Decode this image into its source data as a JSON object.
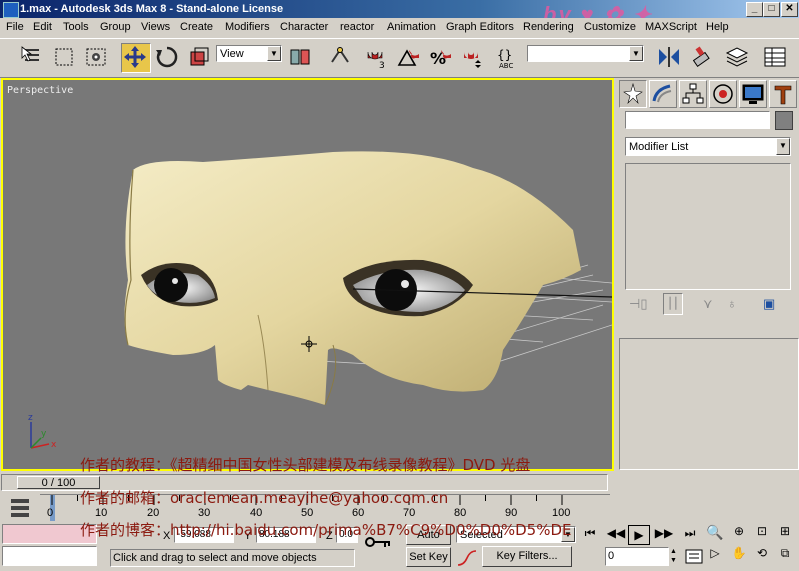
{
  "window": {
    "title": "1.max - Autodesk 3ds Max 8 - Stand-alone License",
    "controls": [
      "_",
      "□",
      "✕"
    ]
  },
  "menu": [
    "File",
    "Edit",
    "Tools",
    "Group",
    "Views",
    "Create",
    "Modifiers",
    "Character",
    "reactor",
    "Animation",
    "Graph Editors",
    "Rendering",
    "Customize",
    "MAXScript",
    "Help"
  ],
  "toolbar": {
    "reference_coord": "View",
    "named_selection": "",
    "icons": [
      "select-object-icon",
      "select-region-icon",
      "window-crossing-icon",
      "select-move-icon",
      "select-rotate-icon",
      "select-scale-icon",
      "pivot-center-icon",
      "select-manipulate-icon",
      "snap-toggle-icon",
      "angle-snap-icon",
      "percent-snap-icon",
      "spinner-snap-icon",
      "edit-named-selection-icon",
      "mirror-icon",
      "align-icon",
      "layer-manager-icon",
      "schematic-view-icon"
    ]
  },
  "viewport": {
    "label": "Perspective"
  },
  "command_panel": {
    "tabs": [
      "create-tab-icon",
      "modify-tab-icon",
      "hierarchy-tab-icon",
      "motion-tab-icon",
      "display-tab-icon",
      "utilities-tab-icon"
    ],
    "object_name": "",
    "modifier_list": "Modifier List"
  },
  "timeline": {
    "frame_indicator": "0 / 100",
    "ticks": [
      "0",
      "10",
      "20",
      "30",
      "40",
      "50",
      "60",
      "70",
      "80",
      "90",
      "100"
    ]
  },
  "status": {
    "x_label": "X",
    "x_value": "-59.088",
    "y_label": "Y",
    "y_value": "80.188",
    "z_label": "Z",
    "z_value": "0.0",
    "auto_key": "Auto Key",
    "set_key": "Set Key",
    "selected": "Selected",
    "key_filters": "Key Filters...",
    "frame": "0",
    "prompt": "Click and drag to select and move objects"
  },
  "overlay": {
    "line1": "作者的教程：《超精细中国女性头部建模及布线录像教程》DVD 光盘",
    "line2": "作者的邮箱：oraclemean.meayihe@yahoo.com.cn",
    "line3": "作者的博客：http://hi.baidu.com/prima%B7%C9%D0%D0%D5%DE"
  },
  "colors": {
    "title_bar": "#0a246a",
    "viewport_bg": "#787878",
    "viewport_border": "#ffff00",
    "skin": "#e8dcb0",
    "overlay_text": "#8b1a10",
    "active_tool": "#e8c64a"
  }
}
